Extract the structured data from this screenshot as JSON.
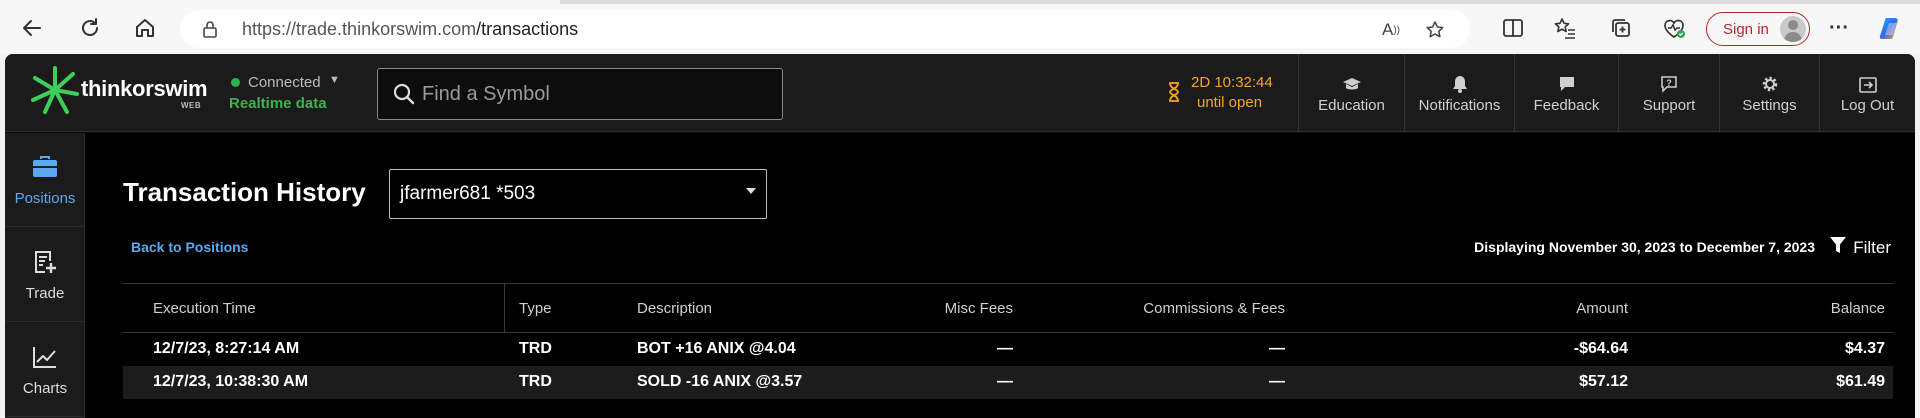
{
  "browser": {
    "url_host": "https://trade.thinkorswim.com",
    "url_path": "/transactions",
    "sign_in_label": "Sign in"
  },
  "header": {
    "logo_text": "thinkorswim",
    "logo_sub": "WEB",
    "connection_status": "Connected",
    "data_mode": "Realtime data",
    "search_placeholder": "Find a Symbol",
    "market_timer": "2D 10:32:44",
    "market_timer_sub": "until open",
    "nav": [
      {
        "label": "Education",
        "icon": "graduation-cap-icon"
      },
      {
        "label": "Notifications",
        "icon": "bell-icon"
      },
      {
        "label": "Feedback",
        "icon": "chat-bubble-icon"
      },
      {
        "label": "Support",
        "icon": "help-bubble-icon"
      },
      {
        "label": "Settings",
        "icon": "gear-icon"
      },
      {
        "label": "Log Out",
        "icon": "logout-icon"
      }
    ]
  },
  "sidebar": {
    "items": [
      {
        "label": "Positions",
        "icon": "briefcase-icon",
        "active": true
      },
      {
        "label": "Trade",
        "icon": "trade-ticket-icon",
        "active": false
      },
      {
        "label": "Charts",
        "icon": "line-chart-icon",
        "active": false
      }
    ]
  },
  "main": {
    "title": "Transaction History",
    "account": "jfarmer681 *503",
    "back_link": "Back to Positions",
    "date_range": "Displaying November 30, 2023 to December 7, 2023",
    "filter_label": "Filter",
    "columns": [
      "Execution Time",
      "Type",
      "Description",
      "Misc Fees",
      "Commissions & Fees",
      "Amount",
      "Balance"
    ],
    "rows": [
      {
        "time": "12/7/23, 8:27:14 AM",
        "type": "TRD",
        "description": "BOT +16 ANIX @4.04",
        "misc_fees": "—",
        "commissions": "—",
        "amount": "-$64.64",
        "balance": "$4.37"
      },
      {
        "time": "12/7/23, 10:38:30 AM",
        "type": "TRD",
        "description": "SOLD -16 ANIX @3.57",
        "misc_fees": "—",
        "commissions": "—",
        "amount": "$57.12",
        "balance": "$61.49"
      }
    ]
  },
  "colors": {
    "accent_blue": "#5aa8f0",
    "connected_green": "#39b54a",
    "timer_orange": "#f5a623",
    "signin_red": "#b4262b"
  }
}
